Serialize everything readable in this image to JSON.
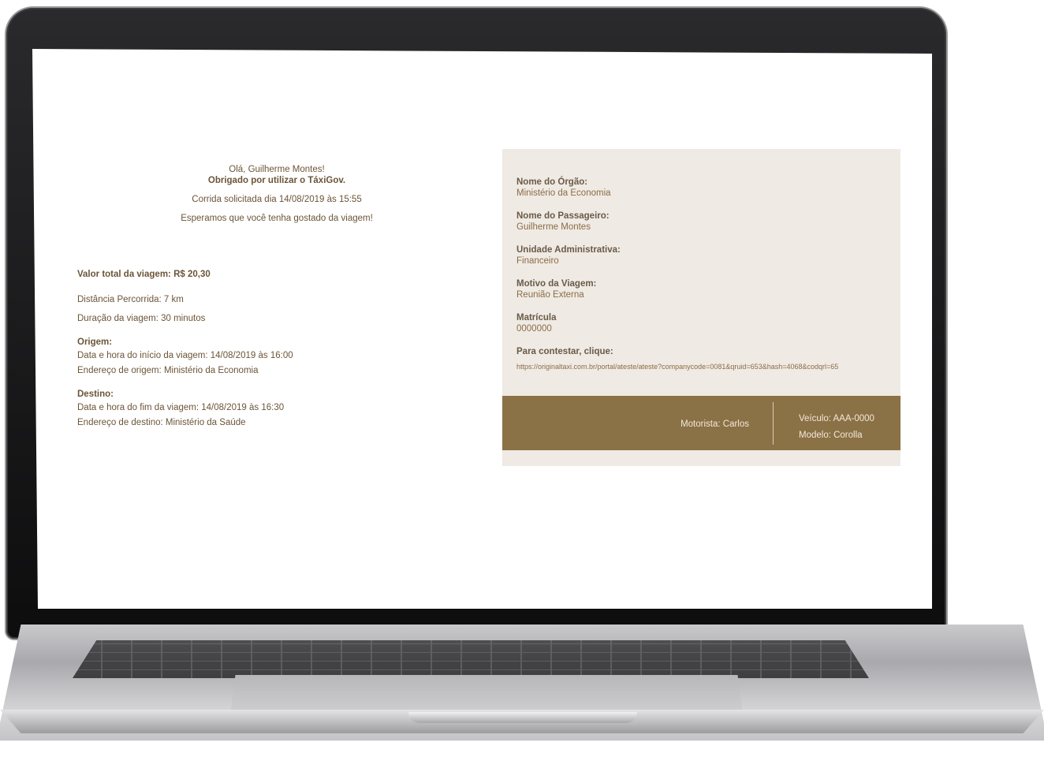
{
  "email": {
    "greeting": "Olá, Guilherme Montes!",
    "thanks": "Obrigado por utilizar o TáxiGov.",
    "requested": "Corrida solicitada dia 14/08/2019 às 15:55",
    "hope": "Esperamos que você tenha gostado da viagem!",
    "total": "Valor total da viagem: R$ 20,30",
    "distance": "Distância Percorrida: 7 km",
    "duration": "Duração da viagem: 30 minutos",
    "origin": {
      "heading": "Origem:",
      "datetime": "Data e hora do início da viagem: 14/08/2019 às 16:00",
      "address": "Endereço de origem: Ministério da Economia"
    },
    "destination": {
      "heading": "Destino:",
      "datetime": "Data e hora do fim da viagem: 14/08/2019 às 16:30",
      "address": "Endereço de destino: Ministério da Saúde"
    }
  },
  "card": {
    "fields": [
      {
        "label": "Nome do Órgão:",
        "value": "Ministério da Economia"
      },
      {
        "label": "Nome do Passageiro:",
        "value": "Guilherme Montes"
      },
      {
        "label": "Unidade Administrativa:",
        "value": "Financeiro"
      },
      {
        "label": "Motivo da Viagem:",
        "value": "Reunião Externa"
      },
      {
        "label": "Matrícula",
        "value": "0000000"
      }
    ],
    "contest_label": "Para contestar, clique:",
    "contest_link": "https://originaltaxi.com.br/portal/ateste/ateste?companycode=0081&qruid=653&hash=4068&codqrl=65",
    "footer": {
      "driver": "Motorista: Carlos",
      "vehicle": "Veículo: AAA-0000",
      "model": "Modelo: Corolla"
    }
  },
  "colors": {
    "text_brown": "#6b5538",
    "card_bg": "#efeae4",
    "footer_bg": "#8b7146"
  }
}
